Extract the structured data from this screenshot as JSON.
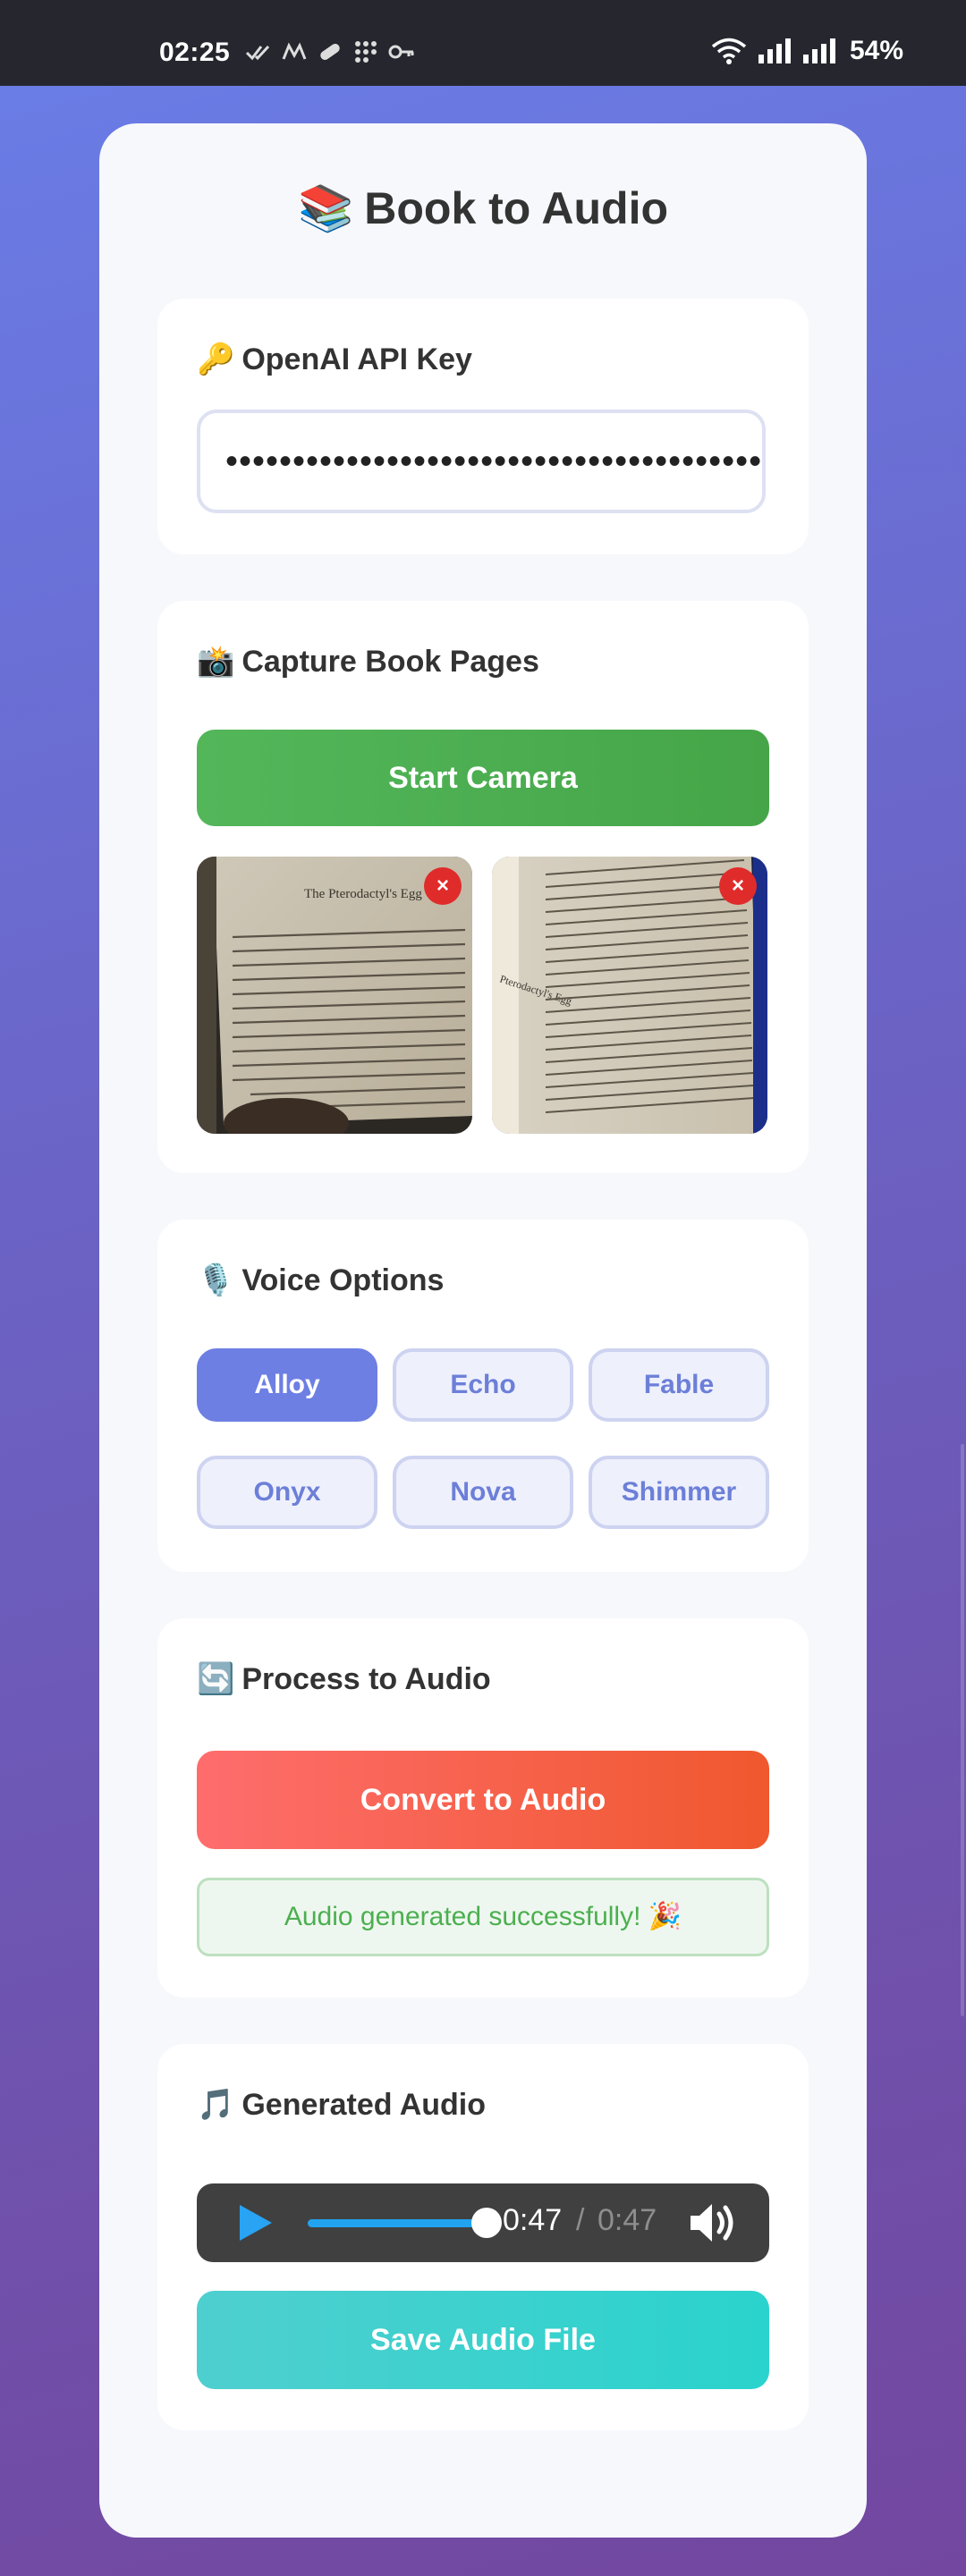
{
  "status_bar": {
    "time": "02:25",
    "battery": "54%",
    "icons_left": [
      "double-check-icon",
      "m-logo-icon",
      "pill-icon",
      "grid-dots-icon",
      "key-icon"
    ],
    "icons_right": [
      "wifi-icon",
      "signal-icon",
      "signal-icon",
      "battery"
    ]
  },
  "app": {
    "title_emoji": "📚",
    "title": "Book to Audio"
  },
  "api_key": {
    "emoji": "🔑",
    "title": "OpenAI API Key",
    "masked_value": "••••••••••••••••••••••••••••••••••••••••••••••"
  },
  "capture": {
    "emoji": "📸",
    "title": "Capture Book Pages",
    "start_camera_label": "Start Camera",
    "remove_label": "×",
    "page1_heading": "The Pterodactyl's Egg",
    "page2_heading": "Pterodactyl's Egg"
  },
  "voice": {
    "emoji": "🎙️",
    "title": "Voice Options",
    "selected": "Alloy",
    "options": [
      "Alloy",
      "Echo",
      "Fable",
      "Onyx",
      "Nova",
      "Shimmer"
    ]
  },
  "process": {
    "emoji": "🔄",
    "title": "Process to Audio",
    "convert_label": "Convert to Audio",
    "status_message": "Audio generated successfully! 🎉"
  },
  "audio": {
    "emoji": "🎵",
    "title": "Generated Audio",
    "current_time": "0:47",
    "separator": "/",
    "total_time": "0:47",
    "progress": 1.0,
    "save_label": "Save Audio File"
  },
  "colors": {
    "accent": "#6d7fe3",
    "green": "#4caf50",
    "convert": "#f0582e",
    "save": "#2ad3cd"
  }
}
